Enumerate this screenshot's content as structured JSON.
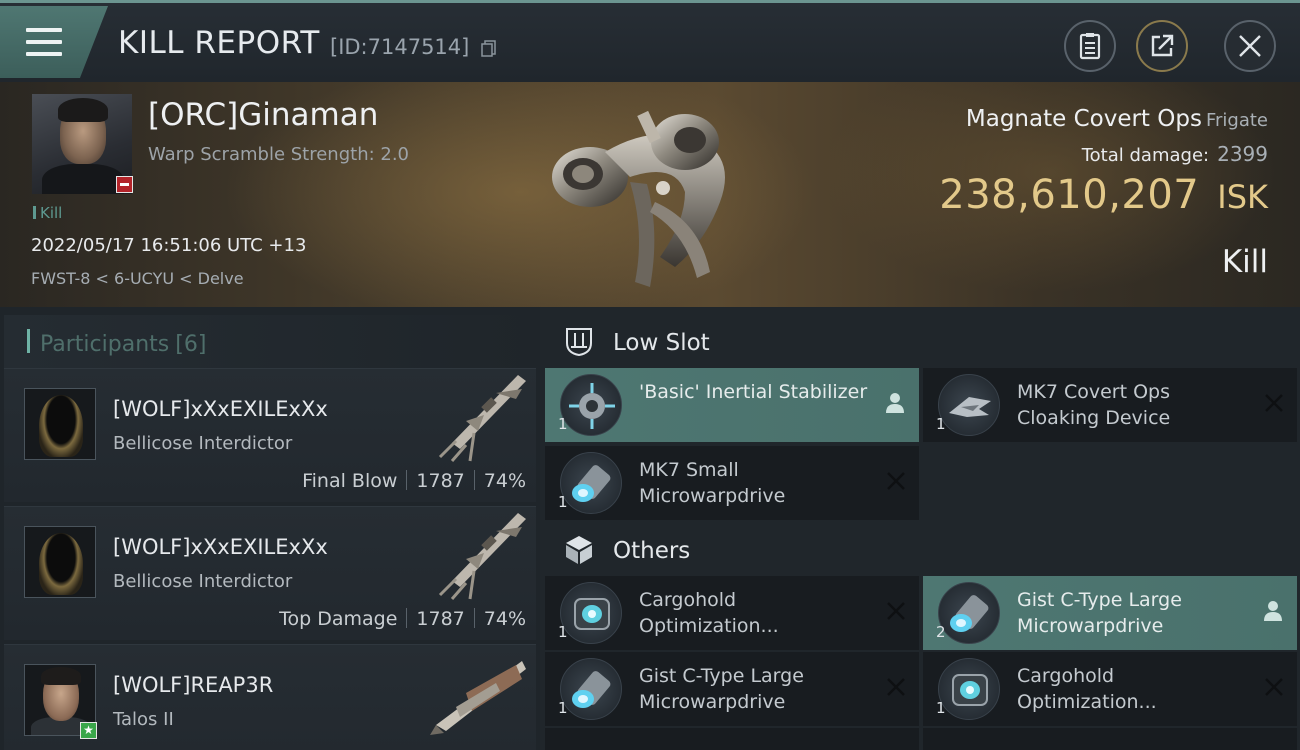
{
  "header": {
    "title": "KILL REPORT",
    "kill_id": "[ID:7147514]"
  },
  "victim": {
    "name": "[ORC]Ginaman",
    "warp_scramble": "Warp Scramble Strength: 2.0",
    "kill_label": "Kill",
    "datetime": "2022/05/17 16:51:06 UTC +13",
    "location": "FWST-8 < 6-UCYU < Delve",
    "ship_name": "Magnate Covert Ops",
    "ship_class": "Frigate",
    "total_damage_label": "Total damage:",
    "total_damage": "2399",
    "isk_value": "238,610,207",
    "isk_currency": "ISK",
    "result": "Kill",
    "security_badge_color": "#b3242a"
  },
  "participants": {
    "title": "Participants",
    "count": "[6]",
    "items": [
      {
        "name": "[WOLF]xXxEXILExXx",
        "ship": "Bellicose Interdictor",
        "role": "Final Blow",
        "damage": "1787",
        "percent": "74%",
        "portrait": "hooded-pilot"
      },
      {
        "name": "[WOLF]xXxEXILExXx",
        "ship": "Bellicose Interdictor",
        "role": "Top Damage",
        "damage": "1787",
        "percent": "74%",
        "portrait": "hooded-pilot"
      },
      {
        "name": "[WOLF]REAP3R",
        "ship": "Talos II",
        "portrait": "male-pilot",
        "badge": "star"
      }
    ]
  },
  "fitting": {
    "low_slot_title": "Low Slot",
    "others_title": "Others",
    "low_slot": [
      {
        "name": "'Basic' Inertial Stabilizer",
        "qty": "1",
        "state": "dropped",
        "icon": "stabilizer-icon"
      },
      {
        "name": "MK7 Covert Ops Cloaking Device",
        "qty": "1",
        "state": "destroyed",
        "icon": "cloak-icon"
      },
      {
        "name": "MK7 Small Microwarpdrive",
        "qty": "1",
        "state": "destroyed",
        "icon": "microwarpdrive-icon"
      }
    ],
    "others": [
      {
        "name": "Cargohold Optimization...",
        "qty": "1",
        "state": "destroyed",
        "icon": "cargohold-icon"
      },
      {
        "name": "Gist C-Type Large Microwarpdrive",
        "qty": "2",
        "state": "dropped",
        "icon": "microwarpdrive-icon"
      },
      {
        "name": "Gist C-Type Large Microwarpdrive",
        "qty": "1",
        "state": "destroyed",
        "icon": "microwarpdrive-icon"
      },
      {
        "name": "Cargohold Optimization...",
        "qty": "1",
        "state": "destroyed",
        "icon": "cargohold-icon"
      }
    ]
  },
  "colors": {
    "accent": "#4e7772",
    "isk": "#e3c98a",
    "background": "#1b2025"
  }
}
